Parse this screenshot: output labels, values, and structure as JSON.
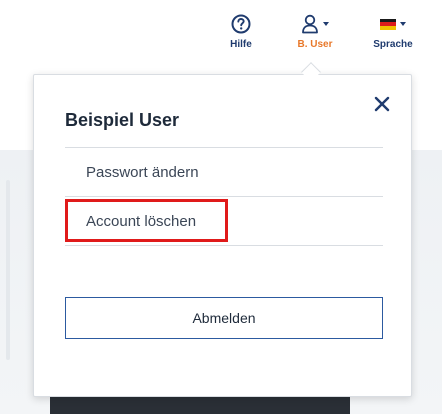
{
  "nav": {
    "help": {
      "label": "Hilfe",
      "icon": "question-circle-icon"
    },
    "user": {
      "label": "B. User",
      "icon": "user-icon",
      "color": "#e8782a"
    },
    "language": {
      "label": "Sprache",
      "icon": "german-flag-icon"
    }
  },
  "dropdown": {
    "user_name": "Beispiel User",
    "close_icon": "close-icon",
    "items": [
      {
        "label": "Passwort ändern"
      },
      {
        "label": "Account löschen",
        "highlighted": true
      }
    ],
    "logout_label": "Abmelden"
  },
  "colors": {
    "brand_dark": "#1f3b6e",
    "accent_orange": "#e8782a",
    "highlight_red": "#e01a1a",
    "button_border": "#2c5aa0"
  }
}
